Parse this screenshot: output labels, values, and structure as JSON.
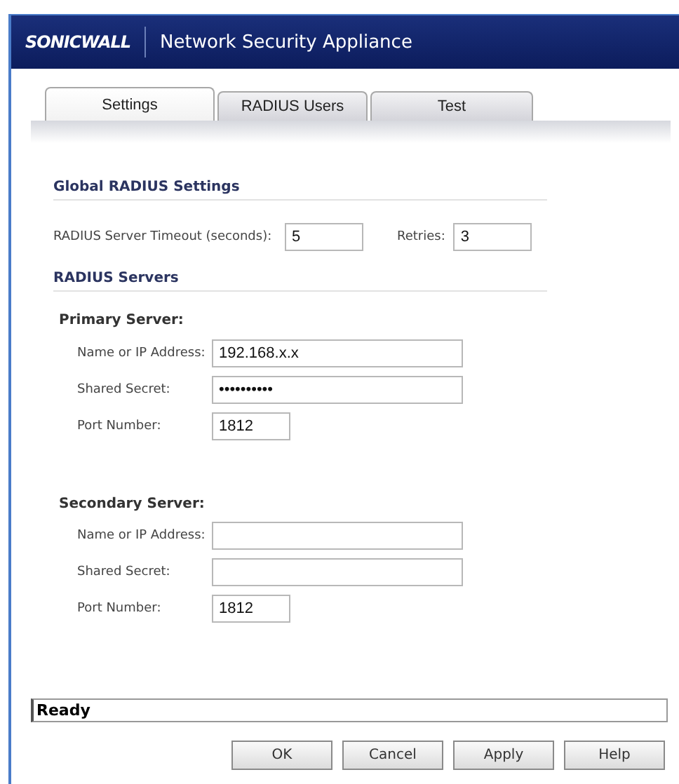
{
  "header": {
    "logo": "SONICWALL",
    "title": "Network Security Appliance"
  },
  "tabs": [
    {
      "label": "Settings",
      "selected": true
    },
    {
      "label": "RADIUS Users",
      "selected": false
    },
    {
      "label": "Test",
      "selected": false
    }
  ],
  "global_settings": {
    "heading": "Global RADIUS Settings",
    "timeout_label": "RADIUS Server Timeout (seconds):",
    "timeout_value": "5",
    "retries_label": "Retries:",
    "retries_value": "3"
  },
  "servers_heading": "RADIUS Servers",
  "servers": [
    {
      "heading": "Primary Server:",
      "fields": [
        {
          "label": "Name or IP Address:",
          "value": "192.168.x.x",
          "kind": "wide"
        },
        {
          "label": "Shared Secret:",
          "value": "••••••••••",
          "kind": "wide"
        },
        {
          "label": "Port Number:",
          "value": "1812",
          "kind": "short"
        }
      ]
    },
    {
      "heading": "Secondary Server:",
      "fields": [
        {
          "label": "Name or IP Address:",
          "kind": "wide"
        },
        {
          "label": "Shared Secret:",
          "kind": "wide"
        },
        {
          "label": "Port Number:",
          "value": "1812",
          "kind": "short"
        }
      ]
    }
  ],
  "status_bar": "Ready",
  "buttons": [
    "OK",
    "Cancel",
    "Apply",
    "Help"
  ]
}
